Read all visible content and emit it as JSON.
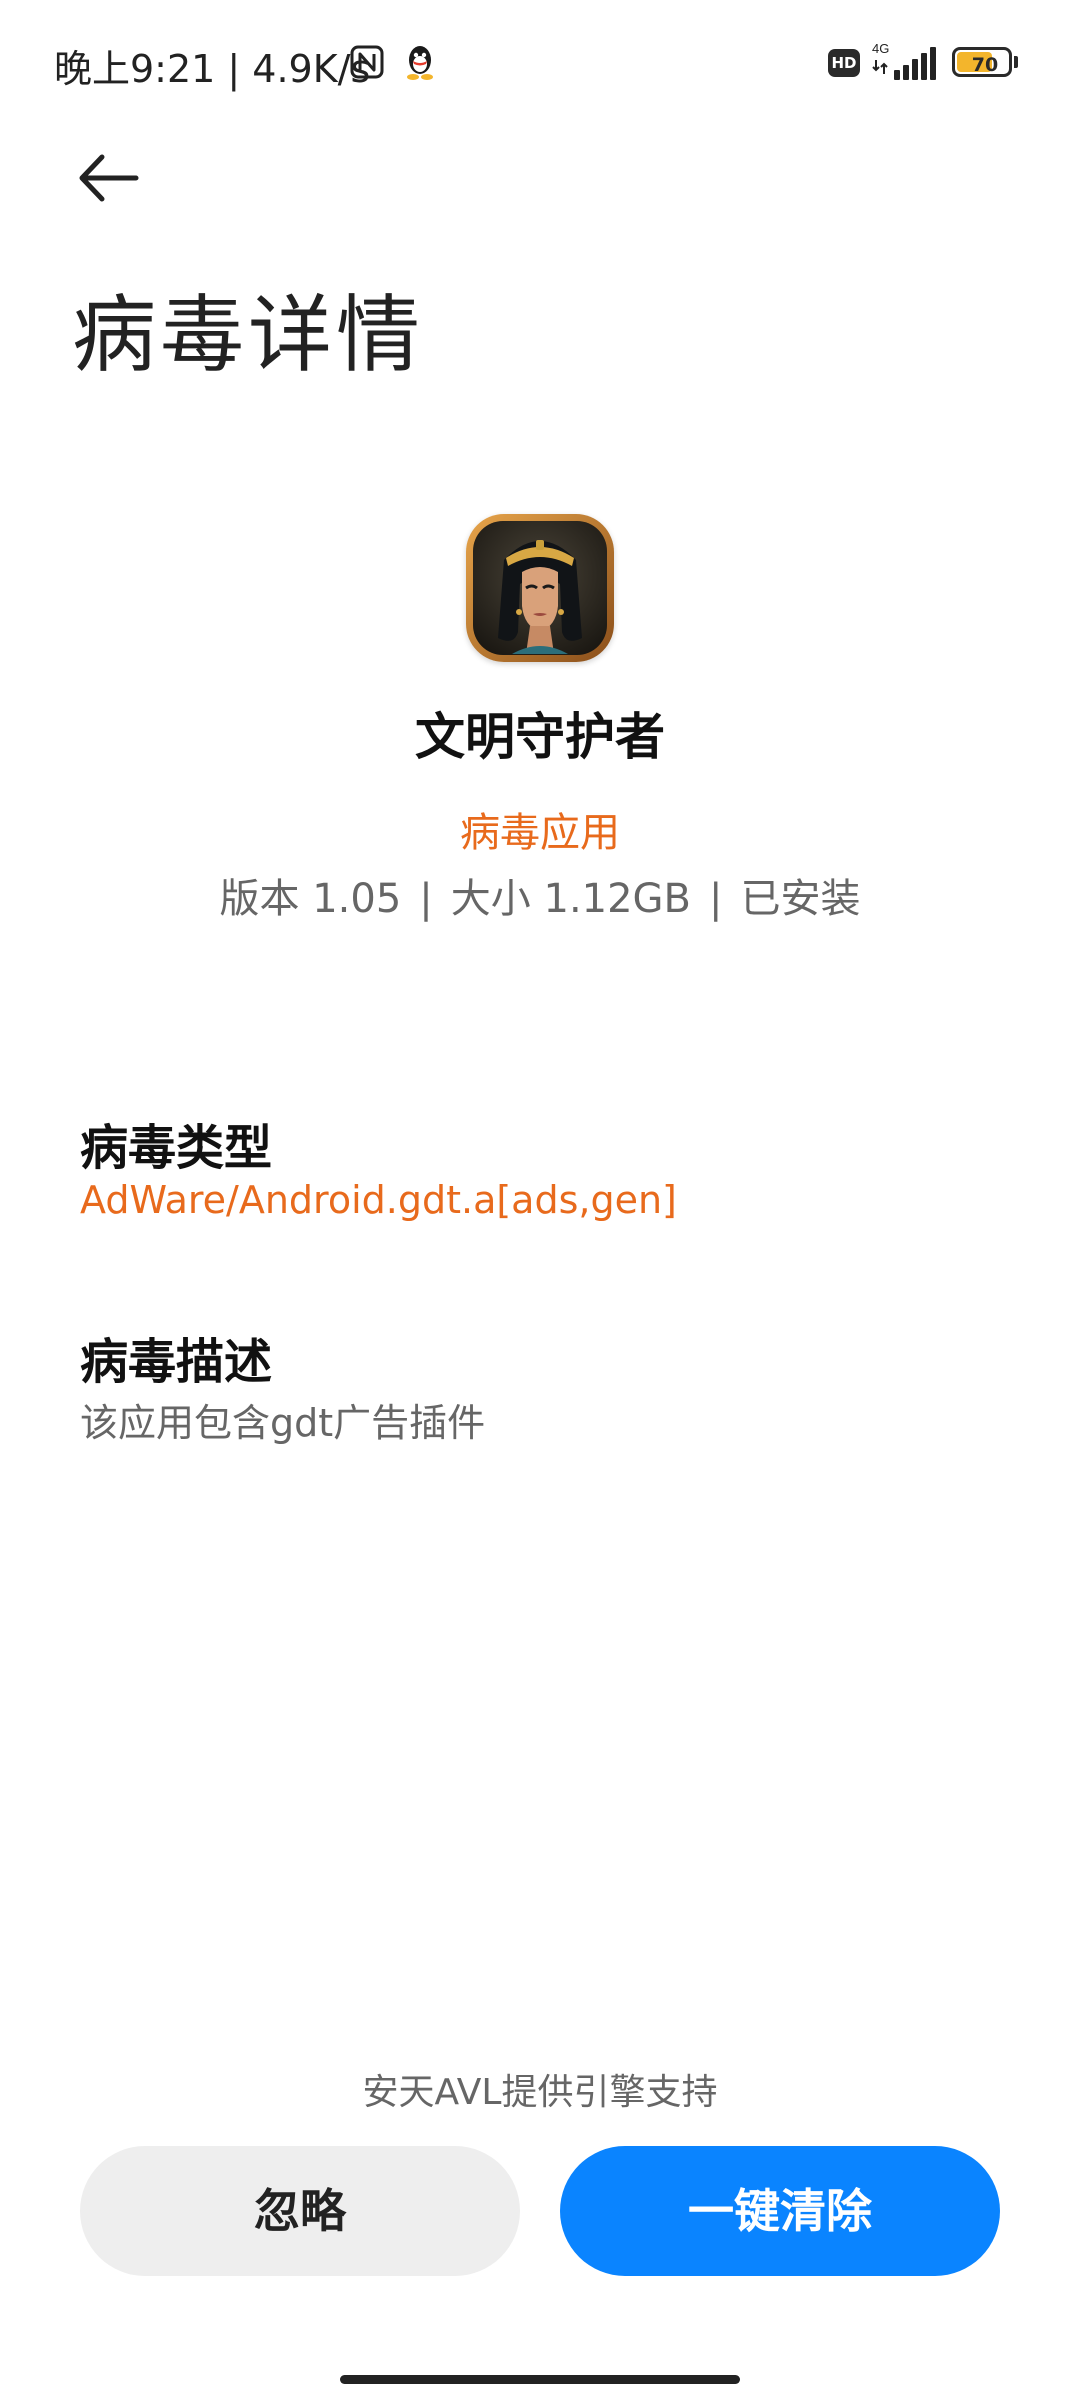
{
  "status_bar": {
    "time_speed": "晚上9:21 | 4.9K/s",
    "network_label": "4G",
    "hd_label": "HD",
    "battery_level": 70,
    "battery_text": "70",
    "icons": [
      "nfc-icon",
      "qq-icon",
      "hd-icon",
      "signal-icon",
      "battery-icon"
    ]
  },
  "header": {
    "back_icon": "arrow-left-icon",
    "title": "病毒详情"
  },
  "app": {
    "name": "文明守护者",
    "status": "病毒应用",
    "version": "版本 1.05",
    "size": "大小 1.12GB",
    "install_state": "已安装",
    "separator": "|"
  },
  "virus_type": {
    "title": "病毒类型",
    "value": "AdWare/Android.gdt.a[ads,gen]"
  },
  "virus_description": {
    "title": "病毒描述",
    "value": "该应用包含gdt广告插件"
  },
  "footer": {
    "engine_note": "安天AVL提供引擎支持",
    "ignore_label": "忽略",
    "clean_label": "一键清除"
  },
  "colors": {
    "accent_orange": "#e86a1c",
    "primary_blue": "#0a84ff",
    "secondary_button": "#eeeeee",
    "battery_fill": "#f3b52c"
  }
}
